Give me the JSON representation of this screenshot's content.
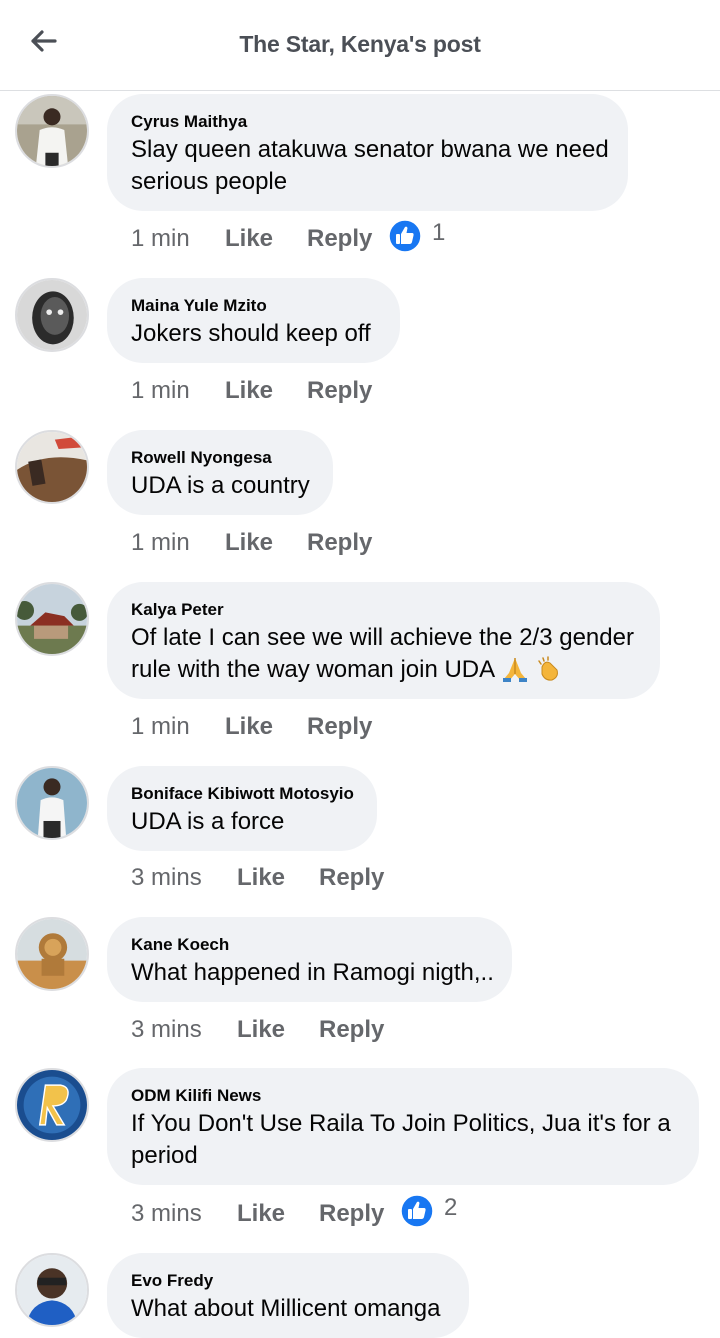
{
  "header": {
    "title": "The Star, Kenya's post",
    "back_icon": "arrow-left-icon"
  },
  "labels": {
    "like": "Like",
    "reply": "Reply"
  },
  "colors": {
    "bubble": "#f0f2f5",
    "like_blue": "#1877f2",
    "meta_grey": "#65676b"
  },
  "comments": [
    {
      "author": "Cyrus Maithya",
      "lines": [
        "Slay queen atakuwa senator bwana we need",
        "serious people"
      ],
      "time": "1 min",
      "reactions": "1"
    },
    {
      "author": "Maina Yule Mzito",
      "lines": [
        "Jokers should keep off"
      ],
      "time": "1 min"
    },
    {
      "author": "Rowell Nyongesa",
      "lines": [
        "UDA is a country"
      ],
      "time": "1 min"
    },
    {
      "author": "Kalya Peter",
      "lines": [
        "Of late I can see we will achieve the 2/3 gender",
        "rule with the way woman join UDA"
      ],
      "emojis": [
        "folded-hands-emoji",
        "clapping-hands-emoji"
      ],
      "time": "1 min"
    },
    {
      "author": "Boniface Kibiwott Motosyio",
      "lines": [
        "UDA is a force"
      ],
      "time": "3 mins"
    },
    {
      "author": "Kane Koech",
      "lines": [
        "What happened in Ramogi nigth,.."
      ],
      "time": "3 mins"
    },
    {
      "author": "ODM Kilifi News",
      "lines": [
        "If You Don't Use Raila To Join Politics, Jua it's for a",
        "period"
      ],
      "time": "3 mins",
      "reactions": "2"
    },
    {
      "author": "Evo Fredy",
      "lines": [
        "What about Millicent omanga"
      ]
    }
  ]
}
